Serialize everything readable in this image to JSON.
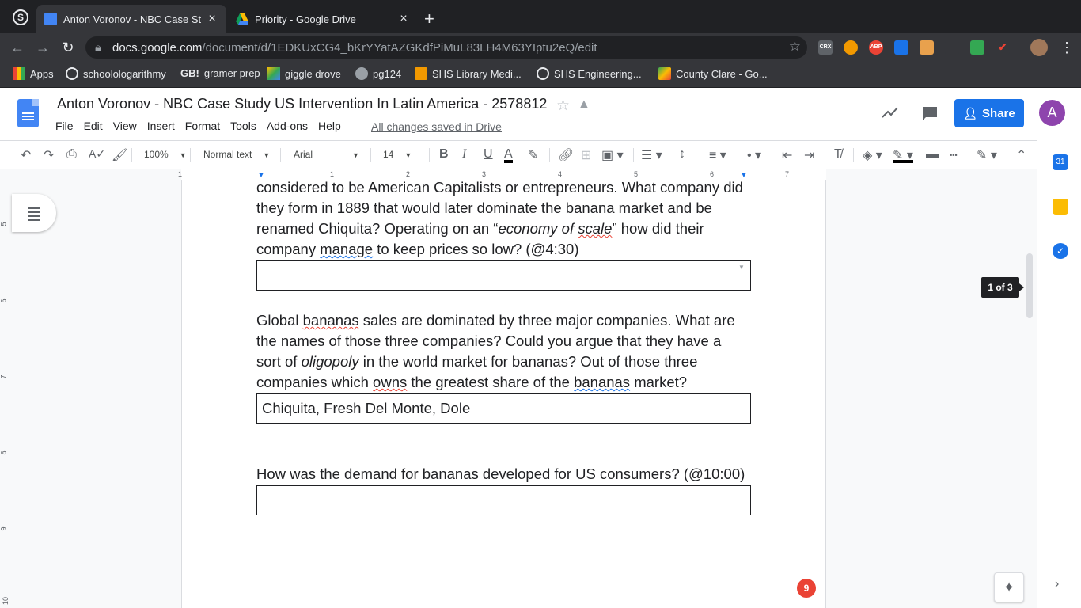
{
  "browser": {
    "tabs": [
      {
        "title": "Anton Voronov - NBC Case Stu",
        "active": true
      },
      {
        "title": "Priority - Google Drive",
        "active": false
      }
    ],
    "close_glyph": "×",
    "newtab_glyph": "+",
    "url_host": "docs.google.com",
    "url_path": "/document/d/1EDKUxCG4_bKrYYatAZGKdfPiMuL83LH4M63YIptu2eQ/edit",
    "extensions": [
      "CRX",
      "ABP"
    ],
    "bookmarks": [
      "Apps",
      "schoolologarithmy",
      "gramer prep",
      "giggle drove",
      "pg124",
      "SHS Library Medi...",
      "SHS Engineering...",
      "County Clare - Go..."
    ]
  },
  "docs": {
    "title": "Anton Voronov - NBC Case Study US Intervention In Latin America - 2578812",
    "menu": [
      "File",
      "Edit",
      "View",
      "Insert",
      "Format",
      "Tools",
      "Add-ons",
      "Help"
    ],
    "saved_status": "All changes saved in Drive",
    "share_label": "Share",
    "avatar_letter": "A"
  },
  "toolbar": {
    "zoom": "100%",
    "style": "Normal text",
    "font": "Arial",
    "size": "14",
    "bold": "B",
    "italic": "I",
    "underline": "U"
  },
  "ruler": {
    "h": [
      "1",
      "1",
      "2",
      "3",
      "4",
      "5",
      "6",
      "7"
    ],
    "v": [
      "5",
      "6",
      "7",
      "8",
      "9",
      "10"
    ]
  },
  "document": {
    "q1": {
      "line1": "considered to be American Capitalists or entrepreneurs. What company did",
      "line2": "they form in 1889 that would later dominate the banana market and be",
      "line3": "renamed Chiquita? Operating on an “",
      "line3_italic1": "economy of ",
      "line3_italic2": "scale",
      "line3_end": "” how did their",
      "line4a": "company ",
      "line4b": "manage",
      "line4c": " to keep prices so low? (@4:30)",
      "answer": ""
    },
    "q2": {
      "line1a": "Global ",
      "line1b": "bananas",
      "line1c": " sales are dominated by three major companies. What are",
      "line2": "the names of those three companies? Could you argue that they have a",
      "line3a": "sort of ",
      "line3b": "oligopoly",
      "line3c": " in the world market for bananas? Out of those three",
      "line4a": "companies which ",
      "line4b": "owns",
      "line4c": " the greatest share of the ",
      "line4d": "bananas",
      "line4e": " market?",
      "answer": "Chiquita, Fresh Del Monte, Dole"
    },
    "q3": {
      "text": "How was the demand for bananas developed for US consumers? (@10:00)",
      "answer": ""
    }
  },
  "page_indicator": "1 of 3",
  "notification_count": "9",
  "colors": {
    "share": "#1a73e8",
    "avatar": "#8e44ad",
    "spell_error": "#ea4335",
    "grammar": "#1a73e8"
  }
}
